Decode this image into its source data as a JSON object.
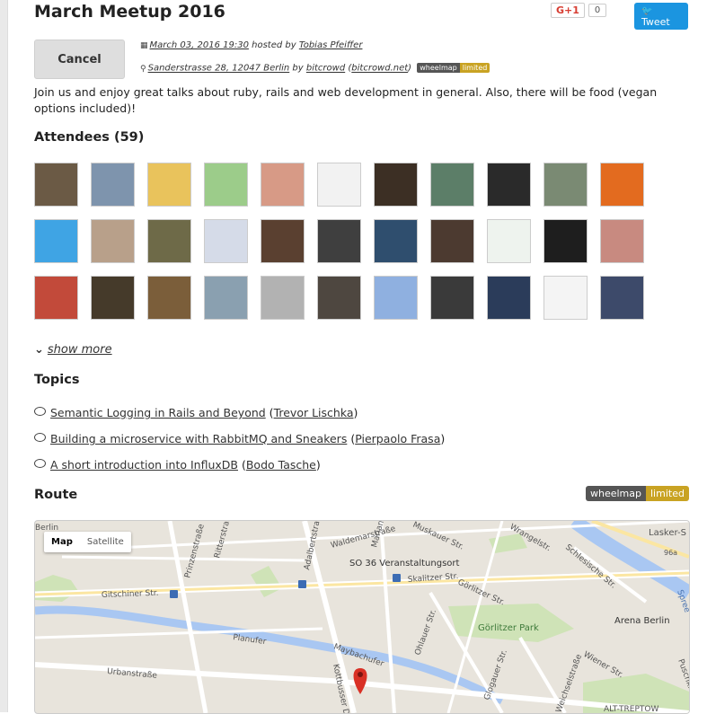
{
  "event": {
    "title": "March Meetup 2016",
    "date_link": "March 03, 2016 19:30",
    "hosted_by_text": "hosted by",
    "host": "Tobias Pfeiffer",
    "address": "Sanderstrasse 28, 12047 Berlin",
    "by_text": "by",
    "organizer": "bitcrowd",
    "organizer_url": "bitcrowd.net",
    "description": "Join us and enjoy great talks about ruby, rails and web development in general. Also, there will be food (vegan options included)!"
  },
  "social": {
    "gplus_label": "G+1",
    "gplus_count": "0",
    "tweet_label": "Tweet",
    "bird_icon": "twitter-bird-icon"
  },
  "actions": {
    "cancel_label": "Cancel"
  },
  "wheelmap": {
    "left": "wheelmap",
    "right": "limited"
  },
  "attendees": {
    "heading": "Attendees (59)",
    "show_more": "show more",
    "avatar_colors": [
      "#6b5a45",
      "#7e94ad",
      "#e9c35c",
      "#9ccc8a",
      "#d79a86",
      "#f2f2f2",
      "#3c2f24",
      "#5c7e68",
      "#2a2a2a",
      "#7a8a73",
      "#e36b1f",
      "#3fa4e4",
      "#b8a08a",
      "#6e6a48",
      "#d5dbe8",
      "#5a4030",
      "#3f3f3f",
      "#2f4e6e",
      "#4c3a30",
      "#eef3ee",
      "#1e1e1e",
      "#c88a80",
      "#c24a3a",
      "#453a2a",
      "#7b5e3a",
      "#8aa0b0",
      "#b2b2b2",
      "#4e4740",
      "#8fb0e0",
      "#3a3a3a",
      "#2b3c5a",
      "#f4f4f4",
      "#3d4a6a"
    ]
  },
  "topics": {
    "heading": "Topics",
    "items": [
      {
        "title": "Semantic Logging in Rails and Beyond",
        "speaker": "Trevor Lischka"
      },
      {
        "title": "Building a microservice with RabbitMQ and Sneakers",
        "speaker": "Pierpaolo Frasa"
      },
      {
        "title": "A short introduction into InfluxDB",
        "speaker": "Bodo Tasche"
      }
    ]
  },
  "route": {
    "heading": "Route",
    "map_tab_active": "Map",
    "map_tab_satellite": "Satellite",
    "labels": [
      "Berlin",
      "Ritterstraße",
      "Prinzenstraße",
      "Adalbertstraße",
      "Waldemarstraße",
      "Mariannenstraße",
      "Muskauer Str.",
      "Wrangelstr.",
      "SO 36 Veranstaltungsort",
      "Skalitzer Str.",
      "Gitschiner Str.",
      "Görlitzer Str.",
      "Görlitzer Park",
      "Schlesische Str.",
      "Arena Berlin",
      "Urbanstraße",
      "Maybachufer",
      "Ohlauer Str.",
      "Kottbusser Damm",
      "Glogauer Str.",
      "Weichselstraße",
      "Lasker-S",
      "96a",
      "ALT-TREPTOW",
      "Spree",
      "Puschkinallee",
      "Planufer",
      "Wiener Str."
    ]
  }
}
